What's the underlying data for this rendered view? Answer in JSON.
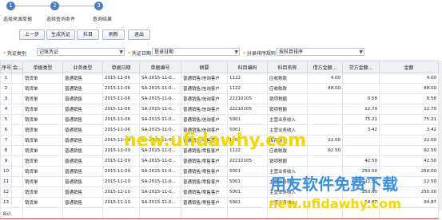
{
  "steps": [
    "选择来源单据",
    "选择查询条件",
    "查询结果"
  ],
  "step_numbers": [
    "1",
    "2",
    "3"
  ],
  "toolbar": [
    "上一步",
    "生成凭证",
    "栏目",
    "刷新",
    "退出"
  ],
  "filters": {
    "voucher_type_label": "凭证类别",
    "voucher_type_value": "记账凭证",
    "voucher_date_label": "凭证日期",
    "voucher_date_value": "登录日期",
    "entry_rule_label": "分录排序规则",
    "entry_rule_value": "按科目排序"
  },
  "columns": [
    "序号",
    "会...",
    "单据类型",
    "业务类型",
    "单据日期",
    "单据编号",
    "摘要",
    "科目编码",
    "科目名称",
    "借方金额...",
    "贷方金额...",
    "金额"
  ],
  "rows": [
    [
      "1",
      "",
      "销货单",
      "普通销售",
      "2015-11-06",
      "SA-2015-11-0...",
      "普通销售/信询客户",
      "1122",
      "应收账款",
      "4.00",
      "",
      "4.00"
    ],
    [
      "2",
      "",
      "销货单",
      "普通销售",
      "2015-11-06",
      "SA-2015-11-0...",
      "普通销售/信询客户",
      "1122",
      "应收账款",
      "88.00",
      "",
      "88.00"
    ],
    [
      "3",
      "",
      "销货单",
      "普通销售",
      "2015-11-06",
      "SA-2015-11-0...",
      "普通销售/信询客户",
      "22210105",
      "销项税额",
      "",
      "0.58",
      "0.58"
    ],
    [
      "4",
      "",
      "销货单",
      "普通销售",
      "2015-11-06",
      "SA-2015-11-0...",
      "普通销售/信询客户",
      "22210105",
      "销项税额",
      "",
      "12.79",
      "12.79"
    ],
    [
      "5",
      "",
      "销货单",
      "普通销售",
      "2015-11-06",
      "SA-2015-11-0...",
      "普通销售/信询客户",
      "5001",
      "主营业务收入",
      "",
      "75.21",
      "75.21"
    ],
    [
      "6",
      "",
      "销货单",
      "普通销售",
      "2015-11-06",
      "SA-2015-11-0...",
      "普通销售/信询客户",
      "5001",
      "主营业务收入",
      "",
      "3.42",
      "3.42"
    ],
    [
      "7",
      "",
      "销货单",
      "普通销售",
      "2015-11-09",
      "SA-2015-11-0...",
      "普通销售/零售客户",
      "1001",
      "库存现金",
      "22.00",
      "",
      "22.00"
    ],
    [
      "8",
      "",
      "销货单",
      "普通销售",
      "2015-11-09",
      "SA-2015-11-0...",
      "普通销售/零售客户",
      "1122",
      "应收账款",
      "92.50",
      "",
      "92.50"
    ],
    [
      "9",
      "",
      "销货单",
      "普通销售",
      "2015-11-09",
      "SA-2015-11-0...",
      "普通销售/零售客户",
      "22210105",
      "销项税额",
      "",
      "42.50",
      "42.50"
    ],
    [
      "10",
      "",
      "销货单",
      "普通销售",
      "2015-11-09",
      "SA-2015-11-0...",
      "普通销售/零售客户",
      "5001",
      "主营业务收入",
      "",
      "250.00",
      "250.00"
    ],
    [
      "11",
      "",
      "销货单",
      "普通销售",
      "2015-11-10",
      "SA-2015-11-0...",
      "普通销售/零售客户",
      "5001",
      "主营业务收入",
      "",
      "12.50",
      "12.50"
    ],
    [
      "12",
      "",
      "销货单",
      "普通销售",
      "2015-11-10",
      "SA-2015-11-0...",
      "普通销售/零售客户",
      "5001",
      "主营业务收入",
      "",
      "250.00",
      "250.00"
    ],
    [
      "13",
      "",
      "销货单",
      "普通销售",
      "2015-11-10",
      "SA-2015-11-0...",
      "普通销售/零售客户",
      "5001",
      "主营业务收入",
      "",
      "94.87",
      "94.87"
    ]
  ],
  "total_label": "合计",
  "watermarks": [
    "new.ufidawhy.com",
    "用友软件免费下载",
    "new.ufidawhy.com"
  ],
  "colors": {
    "accent": "#4a7fbf",
    "total_border": "#d24a3c",
    "watermark_yellow": "#f2d700",
    "watermark_blue": "#3a8fe0"
  }
}
